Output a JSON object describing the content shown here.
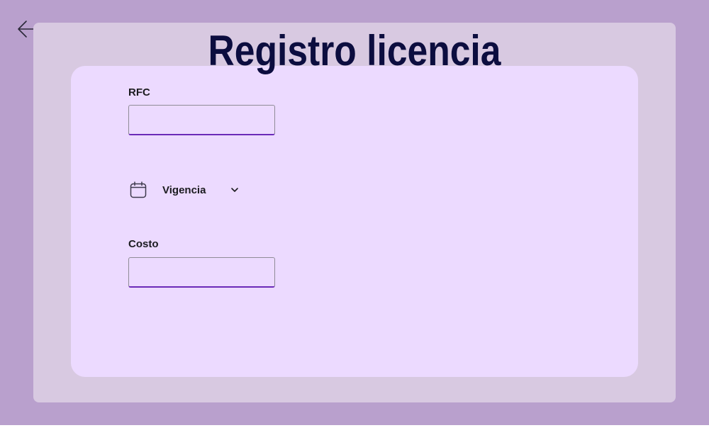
{
  "page": {
    "title": "Registro licencia"
  },
  "nav": {
    "back_icon": "arrow-left-icon"
  },
  "form": {
    "rfc": {
      "label": "RFC",
      "value": "",
      "placeholder": ""
    },
    "vigencia": {
      "label": "Vigencia",
      "leading_icon": "calendar-icon",
      "trailing_icon": "chevron-down-icon"
    },
    "costo": {
      "label": "Costo",
      "value": "",
      "placeholder": ""
    }
  },
  "colors": {
    "background": "#b9a0cd",
    "outer_panel": "#d8c9e1",
    "inner_panel": "#ecdaff",
    "title": "#0c0d3f",
    "field_accent": "#6a2ab8"
  }
}
